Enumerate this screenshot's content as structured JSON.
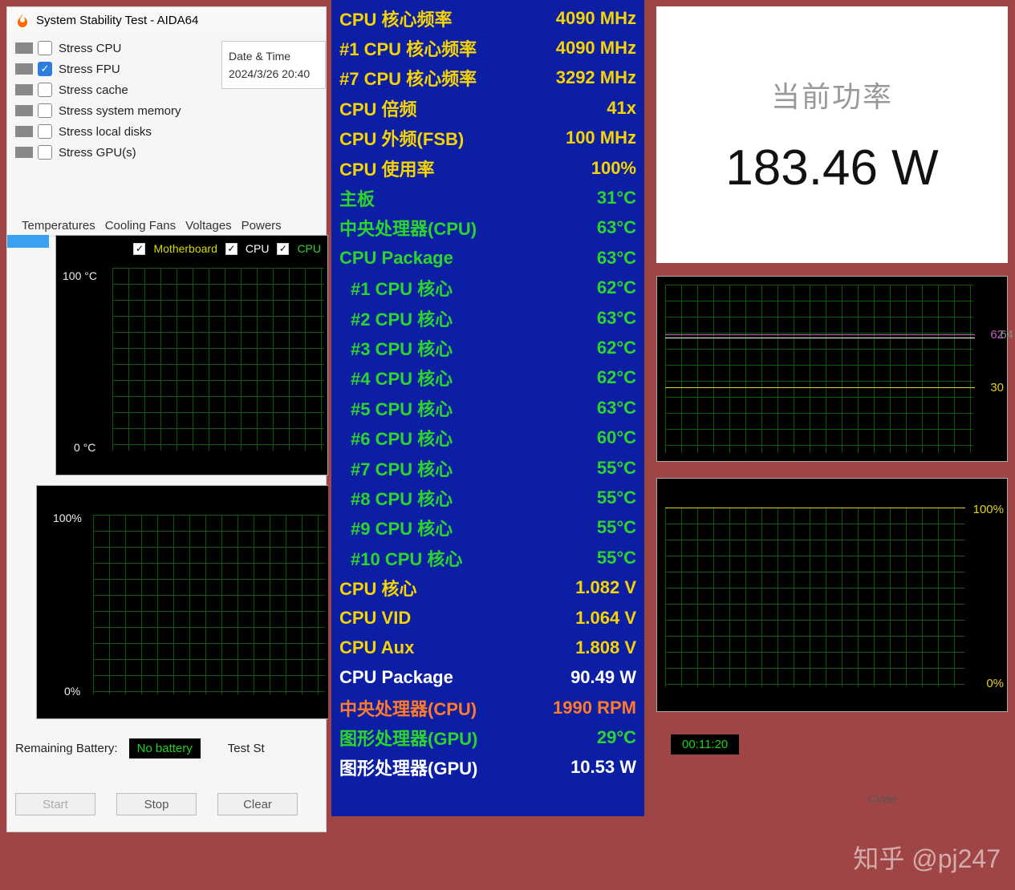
{
  "window": {
    "title": "System Stability Test - AIDA64"
  },
  "stress": [
    {
      "label": "Stress CPU",
      "checked": false
    },
    {
      "label": "Stress FPU",
      "checked": true
    },
    {
      "label": "Stress cache",
      "checked": false
    },
    {
      "label": "Stress system memory",
      "checked": false
    },
    {
      "label": "Stress local disks",
      "checked": false
    },
    {
      "label": "Stress GPU(s)",
      "checked": false
    }
  ],
  "datetime": {
    "header": "Date & Time",
    "value": "2024/3/26 20:40"
  },
  "tabs": [
    "Temperatures",
    "Cooling Fans",
    "Voltages",
    "Powers"
  ],
  "graph1": {
    "legend_motherboard": "Motherboard",
    "legend_cpu": "CPU",
    "legend_cpu2": "CPU",
    "y_top": "100 °C",
    "y_bot": "0 °C"
  },
  "graph2": {
    "y_top": "100%",
    "y_bot": "0%"
  },
  "graph3": {
    "r1": "62",
    "r1b": "64",
    "r2": "30"
  },
  "graph4": {
    "y_top": "100%",
    "y_bot": "0%"
  },
  "status": {
    "remaining_label": "Remaining Battery:",
    "nobat": "No battery",
    "test_label": "Test St"
  },
  "elapsed": "00:11:20",
  "buttons": {
    "start": "Start",
    "stop": "Stop",
    "clear": "Clear",
    "close": "Close"
  },
  "power": {
    "title": "当前功率",
    "value": "183.46 W"
  },
  "osd": [
    {
      "l": "CPU 核心频率",
      "r": "4090 MHz",
      "c": "c-yellow"
    },
    {
      "l": "#1 CPU 核心频率",
      "r": "4090 MHz",
      "c": "c-yellow"
    },
    {
      "l": "#7 CPU 核心频率",
      "r": "3292 MHz",
      "c": "c-yellow"
    },
    {
      "l": "CPU 倍频",
      "r": "41x",
      "c": "c-yellow"
    },
    {
      "l": "CPU 外频(FSB)",
      "r": "100 MHz",
      "c": "c-yellow"
    },
    {
      "l": "CPU 使用率",
      "r": "100%",
      "c": "c-yellow"
    },
    {
      "l": "主板",
      "r": "31°C",
      "c": "c-green"
    },
    {
      "l": "中央处理器(CPU)",
      "r": "63°C",
      "c": "c-green"
    },
    {
      "l": "CPU Package",
      "r": "63°C",
      "c": "c-green"
    },
    {
      "l": "#1 CPU 核心",
      "r": "62°C",
      "c": "c-green",
      "i": true
    },
    {
      "l": "#2 CPU 核心",
      "r": "63°C",
      "c": "c-green",
      "i": true
    },
    {
      "l": "#3 CPU 核心",
      "r": "62°C",
      "c": "c-green",
      "i": true
    },
    {
      "l": "#4 CPU 核心",
      "r": "62°C",
      "c": "c-green",
      "i": true
    },
    {
      "l": "#5 CPU 核心",
      "r": "63°C",
      "c": "c-green",
      "i": true
    },
    {
      "l": "#6 CPU 核心",
      "r": "60°C",
      "c": "c-green",
      "i": true
    },
    {
      "l": "#7 CPU 核心",
      "r": "55°C",
      "c": "c-green",
      "i": true
    },
    {
      "l": "#8 CPU 核心",
      "r": "55°C",
      "c": "c-green",
      "i": true
    },
    {
      "l": "#9 CPU 核心",
      "r": "55°C",
      "c": "c-green",
      "i": true
    },
    {
      "l": "#10 CPU 核心",
      "r": "55°C",
      "c": "c-green",
      "i": true
    },
    {
      "l": "CPU 核心",
      "r": "1.082 V",
      "c": "c-yellow"
    },
    {
      "l": "CPU VID",
      "r": "1.064 V",
      "c": "c-yellow"
    },
    {
      "l": "CPU Aux",
      "r": "1.808 V",
      "c": "c-yellow"
    },
    {
      "l": "CPU Package",
      "r": "90.49 W",
      "c": "c-white"
    },
    {
      "l": "中央处理器(CPU)",
      "r": "1990 RPM",
      "c": "c-orange"
    },
    {
      "l": "图形处理器(GPU)",
      "r": "29°C",
      "c": "c-green"
    },
    {
      "l": "图形处理器(GPU)",
      "r": "10.53 W",
      "c": "c-white"
    }
  ],
  "watermark": "知乎 @pj247"
}
